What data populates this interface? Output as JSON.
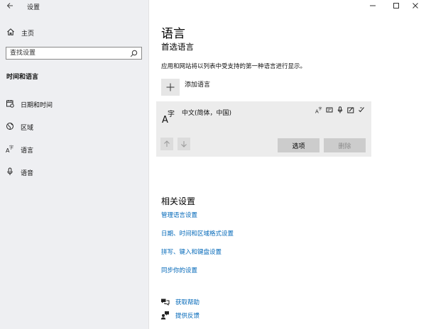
{
  "app": {
    "title": "设置"
  },
  "sidebar": {
    "home": "主页",
    "search_placeholder": "查找设置",
    "section": "时间和语言",
    "items": [
      {
        "label": "日期和时间",
        "icon": "calendar-icon"
      },
      {
        "label": "区域",
        "icon": "globe-icon"
      },
      {
        "label": "语言",
        "icon": "language-icon"
      },
      {
        "label": "语音",
        "icon": "microphone-icon"
      }
    ]
  },
  "main": {
    "title": "语言",
    "subtitle": "首选语言",
    "description": "应用和网站将以列表中受支持的第一种语言进行显示。",
    "add_language": "添加语言",
    "language": {
      "name": "中文(简体，中国)",
      "options_button": "选项",
      "remove_button": "删除"
    },
    "related": {
      "title": "相关设置",
      "links": [
        "管理语言设置",
        "日期、时间和区域格式设置",
        "拼写、键入和键盘设置",
        "同步你的设置"
      ]
    },
    "help": {
      "get_help": "获取帮助",
      "feedback": "提供反馈"
    }
  },
  "colors": {
    "accent": "#0067b8",
    "sidebar_bg": "#eeeff2",
    "card_bg": "#ececec"
  }
}
